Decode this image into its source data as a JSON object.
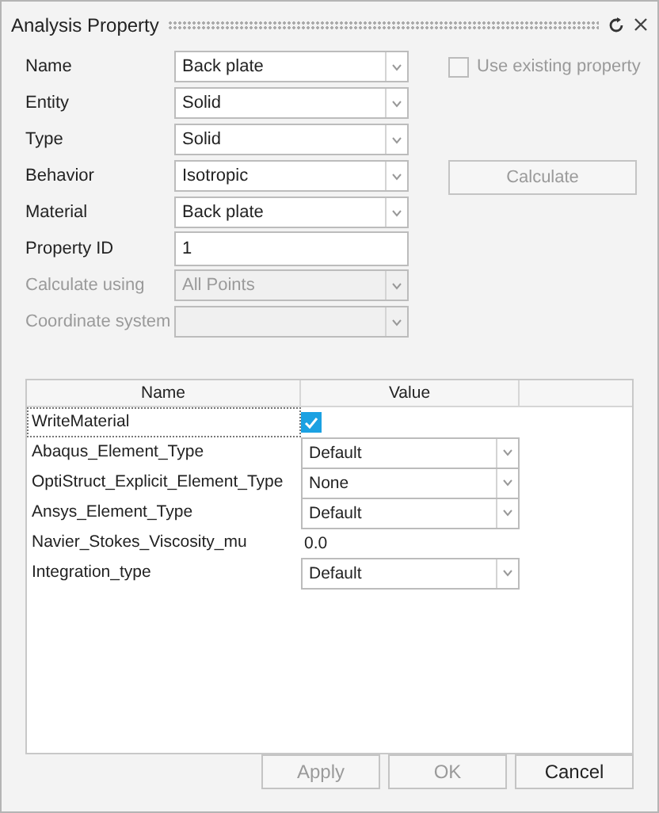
{
  "window": {
    "title": "Analysis Property"
  },
  "form": [
    {
      "label": "Name",
      "kind": "combo",
      "value": "Back plate",
      "disabled": false
    },
    {
      "label": "Entity",
      "kind": "combo",
      "value": "Solid",
      "disabled": false
    },
    {
      "label": "Type",
      "kind": "combo",
      "value": "Solid",
      "disabled": false
    },
    {
      "label": "Behavior",
      "kind": "combo",
      "value": "Isotropic",
      "disabled": false
    },
    {
      "label": "Material",
      "kind": "combo",
      "value": "Back plate",
      "disabled": false
    },
    {
      "label": "Property ID",
      "kind": "text",
      "value": "1",
      "disabled": false
    },
    {
      "label": "Calculate using",
      "kind": "combo",
      "value": "All Points",
      "disabled": true
    },
    {
      "label": "Coordinate system",
      "kind": "combo",
      "disabled": true
    }
  ],
  "use_existing": {
    "label": "Use existing property",
    "checked": false,
    "disabled": true
  },
  "calculate_button": {
    "label": "Calculate",
    "disabled": true
  },
  "table": {
    "columns": [
      "Name",
      "Value"
    ],
    "rows": [
      {
        "name": "WriteMaterial",
        "kind": "check",
        "checked": true,
        "focused": true
      },
      {
        "name": "Abaqus_Element_Type",
        "kind": "combo",
        "value": "Default",
        "focused": false
      },
      {
        "name": "OptiStruct_Explicit_Element_Type",
        "kind": "combo",
        "value": "None",
        "focused": false
      },
      {
        "name": "Ansys_Element_Type",
        "kind": "combo",
        "value": "Default",
        "focused": false
      },
      {
        "name": "Navier_Stokes_Viscosity_mu",
        "kind": "text",
        "value": "0.0",
        "focused": false
      },
      {
        "name": "Integration_type",
        "kind": "combo",
        "value": "Default",
        "focused": false
      }
    ]
  },
  "buttons": [
    {
      "label": "Apply",
      "disabled": true
    },
    {
      "label": "OK",
      "disabled": true
    },
    {
      "label": "Cancel",
      "disabled": false
    }
  ]
}
